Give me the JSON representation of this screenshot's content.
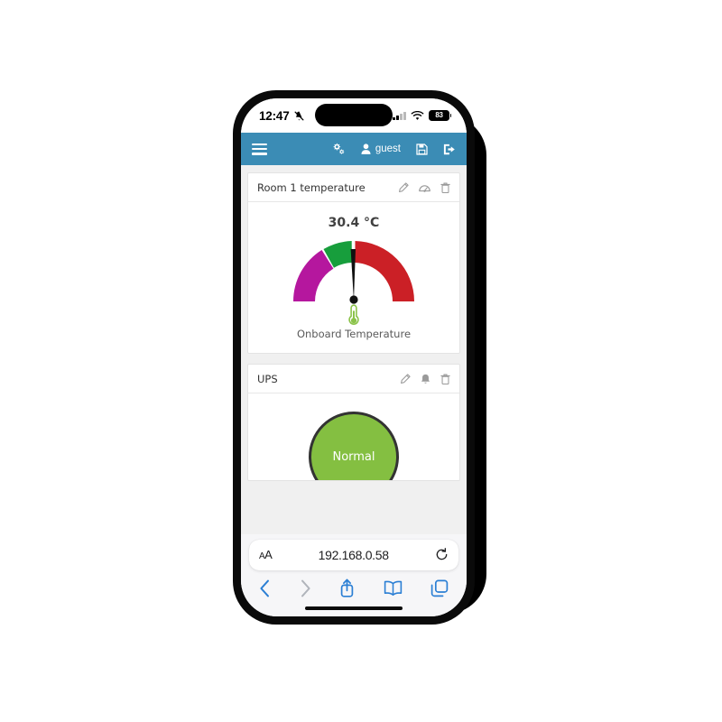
{
  "device": {
    "status_bar": {
      "time": "12:47",
      "silent_icon": "bell-slash-icon",
      "cellular_icon": "cellular-bars-icon",
      "wifi_icon": "wifi-icon",
      "battery_level": "83"
    },
    "home_indicator": "home-indicator"
  },
  "navbar": {
    "menu_icon": "hamburger-menu-icon",
    "settings_icon": "gears-icon",
    "user_icon": "user-icon",
    "user_label": "guest",
    "save_icon": "floppy-save-icon",
    "logout_icon": "sign-out-icon",
    "background_color": "#3b8cb5"
  },
  "cards": [
    {
      "title": "Room 1 temperature",
      "actions": [
        "pencil-edit-icon",
        "gauge-settings-icon",
        "trash-delete-icon"
      ],
      "gauge": {
        "value_label": "30.4 °C",
        "caption": "Onboard Temperature",
        "icon": "thermometer-icon",
        "icon_color": "#8bc34a"
      }
    },
    {
      "title": "UPS",
      "actions": [
        "pencil-edit-icon",
        "bell-alarm-icon",
        "trash-delete-icon"
      ],
      "status": {
        "label": "Normal",
        "color": "#84bf41"
      }
    }
  ],
  "chart_data": {
    "type": "gauge",
    "title": "Onboard Temperature",
    "value": 30.4,
    "value_label": "30.4 °C",
    "unit": "°C",
    "needle_angle_deg": 93,
    "start_angle_deg": 180,
    "end_angle_deg": 0,
    "bands": [
      {
        "name": "low",
        "color": "#b5179e",
        "start_deg": 180,
        "end_deg": 122
      },
      {
        "name": "normal",
        "color": "#179e3c",
        "start_deg": 120,
        "end_deg": 92
      },
      {
        "name": "high",
        "color": "#cb2026",
        "start_deg": 90,
        "end_deg": 0
      }
    ],
    "ylim": [
      0,
      100
    ],
    "grid": false,
    "legend": "none"
  },
  "browser": {
    "text_size_button": "AA",
    "url": "192.168.0.58",
    "reload_icon": "reload-icon",
    "toolbar": {
      "back_icon": "chevron-left-icon",
      "forward_icon": "chevron-right-icon",
      "share_icon": "share-up-icon",
      "bookmarks_icon": "book-icon",
      "tabs_icon": "tabs-icon",
      "active_color": "#2b7fd4",
      "disabled_color": "#b0b4bb"
    }
  }
}
